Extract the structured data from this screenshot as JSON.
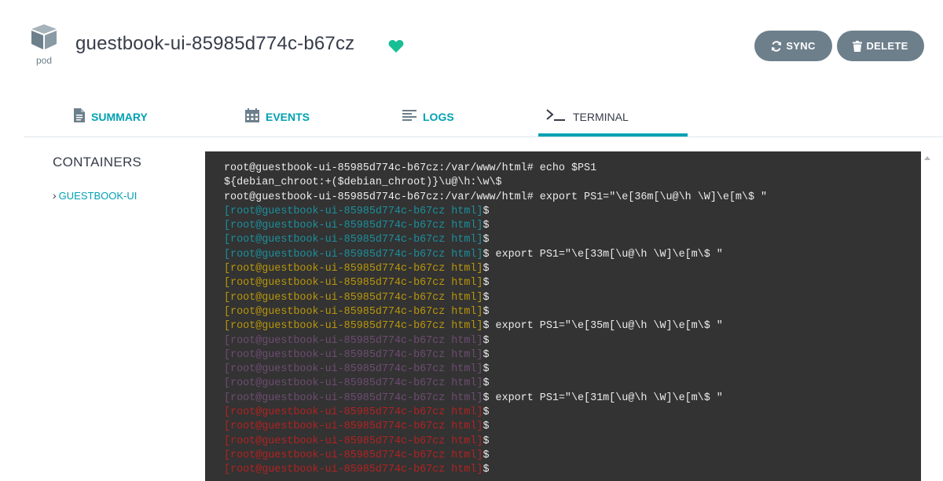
{
  "header": {
    "kind_label": "pod",
    "title": "guestbook-ui-85985d774c-b67cz",
    "health_icon": "heart-icon",
    "health_color": "#18be94",
    "sync_label": "SYNC",
    "delete_label": "DELETE"
  },
  "tabs": [
    {
      "label": "SUMMARY",
      "icon": "file-icon"
    },
    {
      "label": "EVENTS",
      "icon": "calendar-icon"
    },
    {
      "label": "LOGS",
      "icon": "align-left-icon"
    },
    {
      "label": "TERMINAL",
      "icon": "terminal-icon",
      "active": true
    }
  ],
  "containers": {
    "title": "CONTAINERS",
    "items": [
      {
        "label": "GUESTBOOK-UI"
      }
    ]
  },
  "colors": {
    "accent": "#00a2b3",
    "button": "#6d7f8b",
    "terminal_bg": "#333333",
    "cyan": "#1b8f9c",
    "yellow": "#b8960c",
    "magenta": "#6e4c72",
    "red": "#b22222"
  },
  "terminal": {
    "lines": [
      {
        "prompt": "root@guestbook-ui-85985d774c-b67cz:/var/www/html# ",
        "cmd": "echo $PS1",
        "color": "default"
      },
      {
        "prompt": "${debian_chroot:+($debian_chroot)}\\u@\\h:\\w\\$",
        "cmd": "",
        "color": "default"
      },
      {
        "prompt": "root@guestbook-ui-85985d774c-b67cz:/var/www/html# ",
        "cmd": "export PS1=\"\\e[36m[\\u@\\h \\W]\\e[m\\$ \"",
        "color": "default"
      },
      {
        "prompt": "[root@guestbook-ui-85985d774c-b67cz html]",
        "cmd": "$",
        "color": "cyan"
      },
      {
        "prompt": "[root@guestbook-ui-85985d774c-b67cz html]",
        "cmd": "$",
        "color": "cyan"
      },
      {
        "prompt": "[root@guestbook-ui-85985d774c-b67cz html]",
        "cmd": "$",
        "color": "cyan"
      },
      {
        "prompt": "[root@guestbook-ui-85985d774c-b67cz html]",
        "cmd": "$ export PS1=\"\\e[33m[\\u@\\h \\W]\\e[m\\$ \"",
        "color": "cyan"
      },
      {
        "prompt": "[root@guestbook-ui-85985d774c-b67cz html]",
        "cmd": "$",
        "color": "yellow"
      },
      {
        "prompt": "[root@guestbook-ui-85985d774c-b67cz html]",
        "cmd": "$",
        "color": "yellow"
      },
      {
        "prompt": "[root@guestbook-ui-85985d774c-b67cz html]",
        "cmd": "$",
        "color": "yellow"
      },
      {
        "prompt": "[root@guestbook-ui-85985d774c-b67cz html]",
        "cmd": "$",
        "color": "yellow"
      },
      {
        "prompt": "[root@guestbook-ui-85985d774c-b67cz html]",
        "cmd": "$ export PS1=\"\\e[35m[\\u@\\h \\W]\\e[m\\$ \"",
        "color": "yellow"
      },
      {
        "prompt": "[root@guestbook-ui-85985d774c-b67cz html]",
        "cmd": "$",
        "color": "magenta"
      },
      {
        "prompt": "[root@guestbook-ui-85985d774c-b67cz html]",
        "cmd": "$",
        "color": "magenta"
      },
      {
        "prompt": "[root@guestbook-ui-85985d774c-b67cz html]",
        "cmd": "$",
        "color": "magenta"
      },
      {
        "prompt": "[root@guestbook-ui-85985d774c-b67cz html]",
        "cmd": "$",
        "color": "magenta"
      },
      {
        "prompt": "[root@guestbook-ui-85985d774c-b67cz html]",
        "cmd": "$ export PS1=\"\\e[31m[\\u@\\h \\W]\\e[m\\$ \"",
        "color": "magenta"
      },
      {
        "prompt": "[root@guestbook-ui-85985d774c-b67cz html]",
        "cmd": "$",
        "color": "red"
      },
      {
        "prompt": "[root@guestbook-ui-85985d774c-b67cz html]",
        "cmd": "$",
        "color": "red"
      },
      {
        "prompt": "[root@guestbook-ui-85985d774c-b67cz html]",
        "cmd": "$",
        "color": "red"
      },
      {
        "prompt": "[root@guestbook-ui-85985d774c-b67cz html]",
        "cmd": "$",
        "color": "red"
      },
      {
        "prompt": "[root@guestbook-ui-85985d774c-b67cz html]",
        "cmd": "$",
        "color": "red"
      }
    ]
  }
}
